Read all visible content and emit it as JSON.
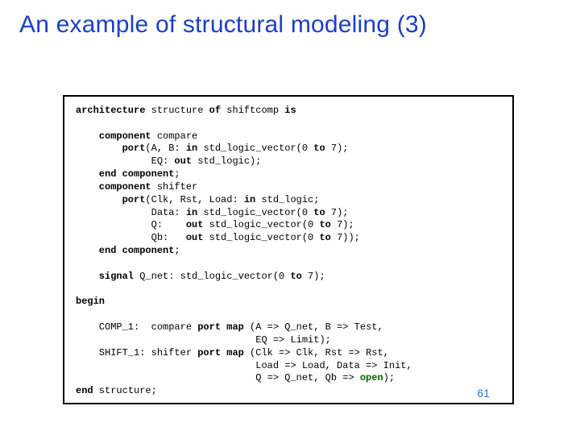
{
  "title": "An example of structural modeling (3)",
  "code": {
    "l01a": "architecture",
    "l01b": " structure ",
    "l01c": "of",
    "l01d": " shiftcomp ",
    "l01e": "is",
    "l02": "",
    "l03a": "    component",
    "l03b": " compare",
    "l04a": "        port",
    "l04b": "(A, B: ",
    "l04c": "in",
    "l04d": " std_logic_vector(0 ",
    "l04e": "to",
    "l04f": " 7);",
    "l05a": "             EQ: ",
    "l05b": "out",
    "l05c": " std_logic);",
    "l06a": "    end component",
    "l06b": ";",
    "l07a": "    component",
    "l07b": " shifter",
    "l08a": "        port",
    "l08b": "(Clk, Rst, Load: ",
    "l08c": "in",
    "l08d": " std_logic;",
    "l09a": "             Data: ",
    "l09b": "in",
    "l09c": " std_logic_vector(0 ",
    "l09d": "to",
    "l09e": " 7);",
    "l10a": "             Q:    ",
    "l10b": "out",
    "l10c": " std_logic_vector(0 ",
    "l10d": "to",
    "l10e": " 7);",
    "l11a": "             Qb:   ",
    "l11b": "out",
    "l11c": " std_logic_vector(0 ",
    "l11d": "to",
    "l11e": " 7));",
    "l12a": "    end component",
    "l12b": ";",
    "l13": "",
    "l14a": "    signal",
    "l14b": " Q_net: std_logic_vector(0 ",
    "l14c": "to",
    "l14d": " 7);",
    "l15": "",
    "l16": "begin",
    "l17": "",
    "l18a": "    COMP_1:  compare ",
    "l18b": "port map",
    "l18c": " (A => Q_net, B => Test,",
    "l19": "                               EQ => Limit);",
    "l20a": "    SHIFT_1: shifter ",
    "l20b": "port map",
    "l20c": " (Clk => Clk, Rst => Rst,",
    "l21": "                               Load => Load, Data => Init,",
    "l22a": "                               Q => Q_net, Qb => ",
    "l22b": "open",
    "l22c": ");",
    "l23a": "end",
    "l23b": " structure;"
  },
  "page_number": "61"
}
